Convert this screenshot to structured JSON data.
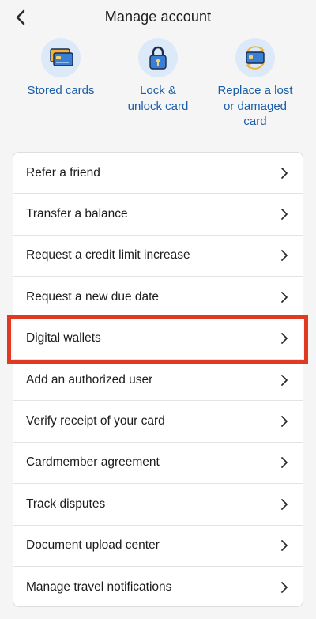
{
  "header": {
    "title": "Manage account"
  },
  "quick_actions": [
    {
      "label_lines": [
        "Stored cards"
      ],
      "icon": "stored-cards-icon"
    },
    {
      "label_lines": [
        "Lock &",
        "unlock card"
      ],
      "icon": "lock-icon"
    },
    {
      "label_lines": [
        "Replace a lost",
        "or damaged",
        "card"
      ],
      "icon": "replace-card-icon"
    }
  ],
  "menu": {
    "items": [
      {
        "label": "Refer a friend"
      },
      {
        "label": "Transfer a balance"
      },
      {
        "label": "Request a credit limit increase"
      },
      {
        "label": "Request a new due date"
      },
      {
        "label": "Digital wallets"
      },
      {
        "label": "Add an authorized user"
      },
      {
        "label": "Verify receipt of your card"
      },
      {
        "label": "Cardmember agreement"
      },
      {
        "label": "Track disputes"
      },
      {
        "label": "Document upload center"
      },
      {
        "label": "Manage travel notifications"
      }
    ],
    "highlighted_item": "Digital wallets"
  },
  "colors": {
    "accent": "#1a5ea8",
    "icon_bg": "#dce9f8",
    "highlight": "#e03a22"
  }
}
